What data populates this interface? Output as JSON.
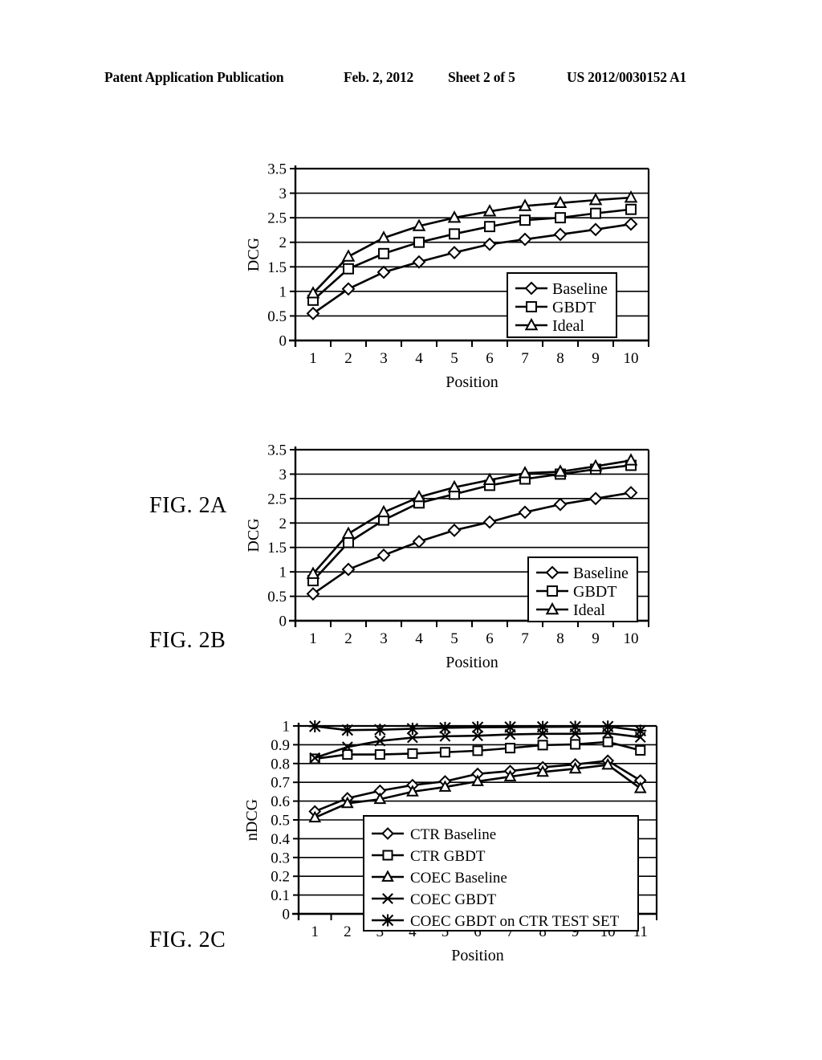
{
  "header": {
    "publication": "Patent Application Publication",
    "date": "Feb. 2, 2012",
    "sheet": "Sheet 2 of 5",
    "number": "US 2012/0030152 A1"
  },
  "figures": [
    {
      "id": "fig-2a",
      "caption": "FIG. 2A"
    },
    {
      "id": "fig-2b",
      "caption": "FIG. 2B"
    },
    {
      "id": "fig-2c",
      "caption": "FIG. 2C"
    }
  ],
  "chart_data": [
    {
      "id": "2A",
      "type": "line",
      "title": "",
      "xlabel": "Position",
      "ylabel": "DCG",
      "x": [
        1,
        2,
        3,
        4,
        5,
        6,
        7,
        8,
        9,
        10
      ],
      "xticklabels": [
        "1",
        "2",
        "3",
        "4",
        "5",
        "6",
        "7",
        "8",
        "9",
        "10"
      ],
      "yticklabels": [
        "0",
        "0.5",
        "1",
        "1.5",
        "2",
        "2.5",
        "3",
        "3.5"
      ],
      "ylim": [
        0,
        3.5
      ],
      "ytickstep": 0.5,
      "grid": true,
      "legend_position": "inside-right",
      "series": [
        {
          "name": "Baseline",
          "marker": "diamond",
          "values": [
            0.55,
            1.05,
            1.39,
            1.6,
            1.79,
            1.96,
            2.06,
            2.16,
            2.26,
            2.37
          ]
        },
        {
          "name": "GBDT",
          "marker": "square",
          "values": [
            0.82,
            1.46,
            1.77,
            2.0,
            2.17,
            2.32,
            2.45,
            2.5,
            2.59,
            2.67
          ]
        },
        {
          "name": "Ideal",
          "marker": "triangle",
          "values": [
            0.96,
            1.71,
            2.09,
            2.33,
            2.5,
            2.63,
            2.74,
            2.8,
            2.86,
            2.91
          ]
        }
      ]
    },
    {
      "id": "2B",
      "type": "line",
      "title": "",
      "xlabel": "Position",
      "ylabel": "DCG",
      "x": [
        1,
        2,
        3,
        4,
        5,
        6,
        7,
        8,
        9,
        10
      ],
      "xticklabels": [
        "1",
        "2",
        "3",
        "4",
        "5",
        "6",
        "7",
        "8",
        "9",
        "10"
      ],
      "yticklabels": [
        "0",
        "0.5",
        "1",
        "1.5",
        "2",
        "2.5",
        "3",
        "3.5"
      ],
      "ylim": [
        0,
        3.5
      ],
      "ytickstep": 0.5,
      "grid": true,
      "legend_position": "inside-right",
      "series": [
        {
          "name": "Baseline",
          "marker": "diamond",
          "values": [
            0.55,
            1.05,
            1.34,
            1.62,
            1.85,
            2.02,
            2.22,
            2.38,
            2.5,
            2.62
          ]
        },
        {
          "name": "GBDT",
          "marker": "square",
          "values": [
            0.82,
            1.6,
            2.06,
            2.41,
            2.59,
            2.77,
            2.9,
            3.0,
            3.1,
            3.18
          ]
        },
        {
          "name": "Ideal",
          "marker": "triangle",
          "values": [
            0.96,
            1.78,
            2.22,
            2.53,
            2.73,
            2.88,
            3.02,
            3.05,
            3.16,
            3.28
          ]
        }
      ]
    },
    {
      "id": "2C",
      "type": "line",
      "title": "",
      "xlabel": "Position",
      "ylabel": "nDCG",
      "x": [
        1,
        2,
        3,
        4,
        5,
        6,
        7,
        8,
        9,
        10,
        11
      ],
      "xticklabels": [
        "1",
        "2",
        "3",
        "4",
        "5",
        "6",
        "7",
        "8",
        "9",
        "10",
        "11"
      ],
      "yticklabels": [
        "0",
        "0.1",
        "0.2",
        "0.3",
        "0.4",
        "0.5",
        "0.6",
        "0.7",
        "0.8",
        "0.9",
        "1"
      ],
      "ylim": [
        0,
        1
      ],
      "ytickstep": 0.1,
      "grid": true,
      "legend_position": "inside-bottom-right",
      "series": [
        {
          "name": "CTR Baseline",
          "marker": "diamond",
          "values": [
            0.545,
            0.615,
            0.655,
            0.685,
            0.705,
            0.745,
            0.76,
            0.78,
            0.795,
            0.815,
            0.71
          ]
        },
        {
          "name": "CTR GBDT",
          "marker": "square",
          "values": [
            0.825,
            0.848,
            0.848,
            0.853,
            0.86,
            0.868,
            0.882,
            0.898,
            0.902,
            0.915,
            0.87
          ]
        },
        {
          "name": "COEC Baseline",
          "marker": "triangle",
          "values": [
            0.512,
            0.588,
            0.61,
            0.65,
            0.675,
            0.705,
            0.73,
            0.755,
            0.772,
            0.793,
            0.668
          ]
        },
        {
          "name": "COEC GBDT",
          "marker": "cross",
          "values": [
            0.83,
            0.888,
            0.92,
            0.938,
            0.945,
            0.948,
            0.955,
            0.958,
            0.958,
            0.962,
            0.94
          ]
        },
        {
          "name": "COEC GBDT on CTR TEST SET",
          "marker": "asterisk",
          "values": [
            0.998,
            0.978,
            0.98,
            0.985,
            0.99,
            0.993,
            0.994,
            0.995,
            0.996,
            0.997,
            0.975
          ]
        }
      ]
    }
  ]
}
